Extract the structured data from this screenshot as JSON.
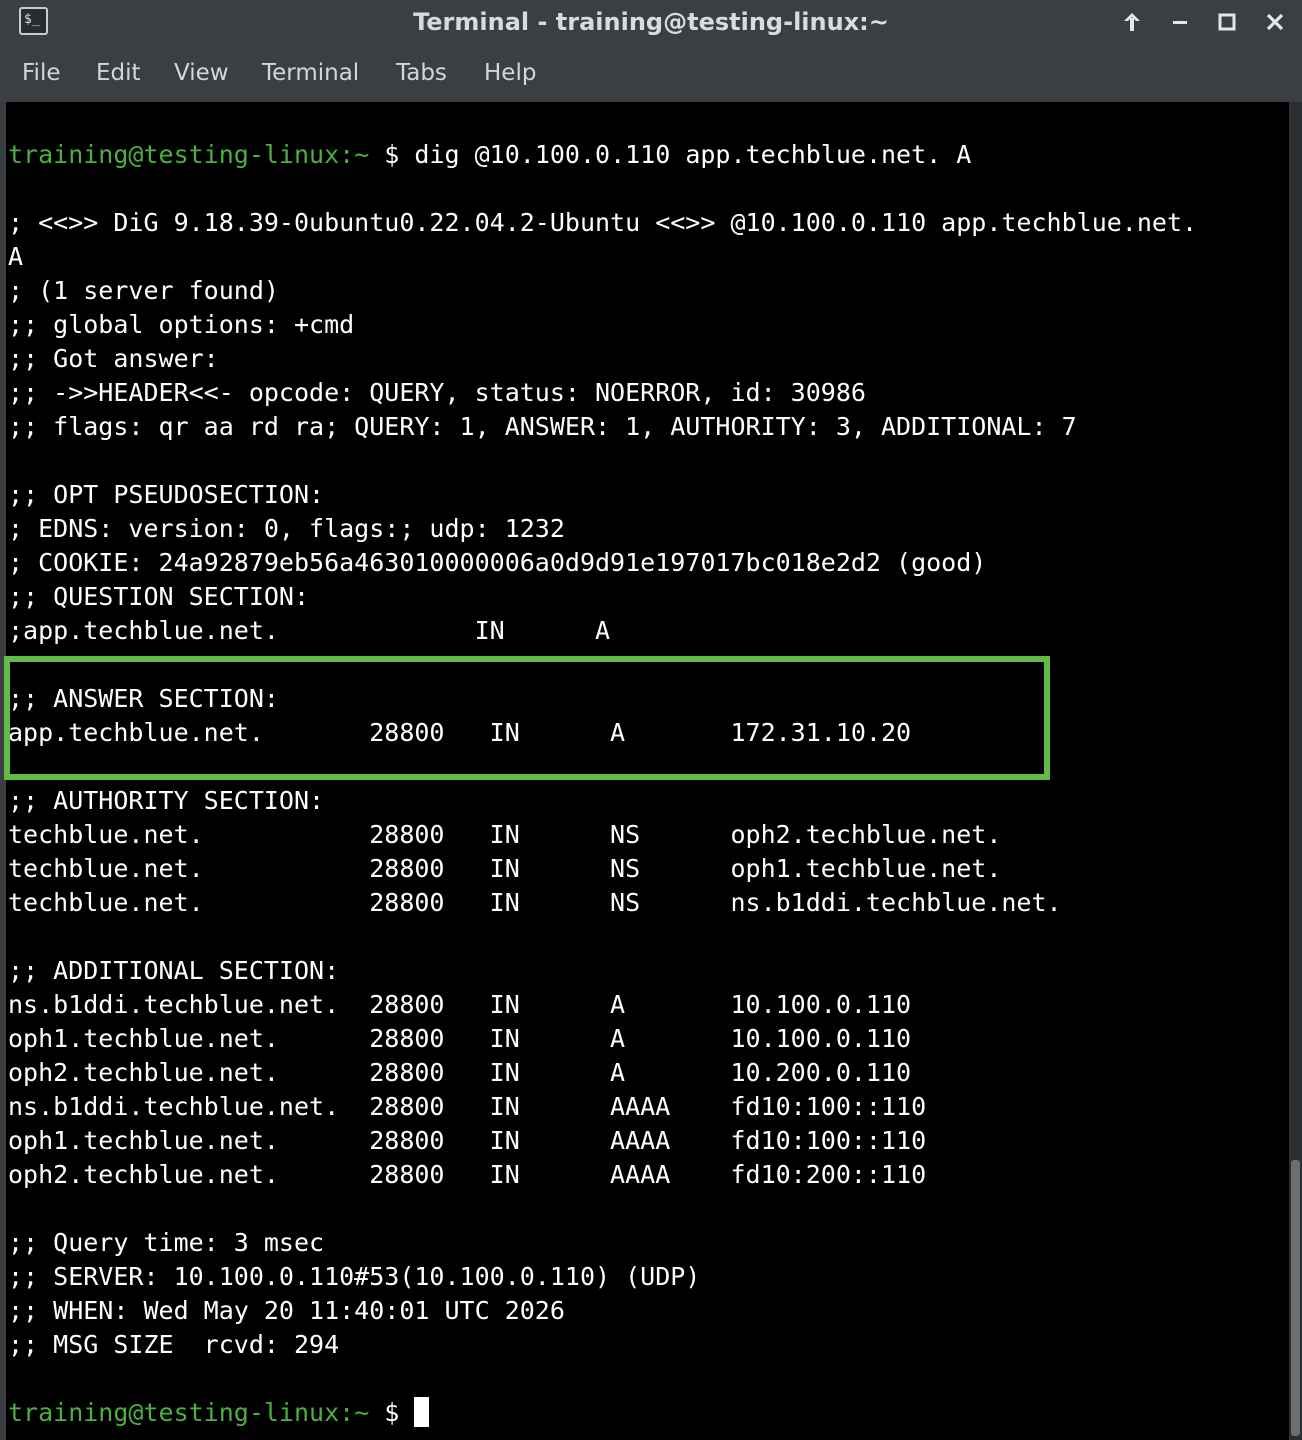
{
  "window": {
    "title": "Terminal - training@testing-linux:~",
    "icon": "terminal-icon",
    "icon_glyph": "$_",
    "controls": {
      "pin": "↑",
      "minimize": "−",
      "maximize": "□",
      "close": "✕"
    }
  },
  "menu": {
    "items": [
      "File",
      "Edit",
      "View",
      "Terminal",
      "Tabs",
      "Help"
    ]
  },
  "terminal": {
    "prompt_user": "training@testing-linux",
    "prompt_path": ":~",
    "prompt_symbol": " $",
    "command": " dig @10.100.0.110 app.techblue.net. A",
    "lines": [
      "; <<>> DiG 9.18.39-0ubuntu0.22.04.2-Ubuntu <<>> @10.100.0.110 app.techblue.net.",
      "A",
      "; (1 server found)",
      ";; global options: +cmd",
      ";; Got answer:",
      ";; ->>HEADER<<- opcode: QUERY, status: NOERROR, id: 30986",
      ";; flags: qr aa rd ra; QUERY: 1, ANSWER: 1, AUTHORITY: 3, ADDITIONAL: 7",
      "",
      ";; OPT PSEUDOSECTION:",
      "; EDNS: version: 0, flags:; udp: 1232",
      "; COOKIE: 24a92879eb56a463010000006a0d9d91e197017bc018e2d2 (good)",
      ";; QUESTION SECTION:",
      ";app.techblue.net.             IN      A",
      "",
      ";; ANSWER SECTION:",
      "app.techblue.net.       28800   IN      A       172.31.10.20",
      "",
      ";; AUTHORITY SECTION:",
      "techblue.net.           28800   IN      NS      oph2.techblue.net.",
      "techblue.net.           28800   IN      NS      oph1.techblue.net.",
      "techblue.net.           28800   IN      NS      ns.b1ddi.techblue.net.",
      "",
      ";; ADDITIONAL SECTION:",
      "ns.b1ddi.techblue.net.  28800   IN      A       10.100.0.110",
      "oph1.techblue.net.      28800   IN      A       10.100.0.110",
      "oph2.techblue.net.      28800   IN      A       10.200.0.110",
      "ns.b1ddi.techblue.net.  28800   IN      AAAA    fd10:100::110",
      "oph1.techblue.net.      28800   IN      AAAA    fd10:100::110",
      "oph2.techblue.net.      28800   IN      AAAA    fd10:200::110",
      "",
      ";; Query time: 3 msec",
      ";; SERVER: 10.100.0.110#53(10.100.0.110) (UDP)",
      ";; WHEN: Wed May 20 11:40:01 UTC 2026",
      ";; MSG SIZE  rcvd: 294",
      ""
    ],
    "highlight_color": "#62bb46",
    "prompt_color": "#4caf3f"
  }
}
